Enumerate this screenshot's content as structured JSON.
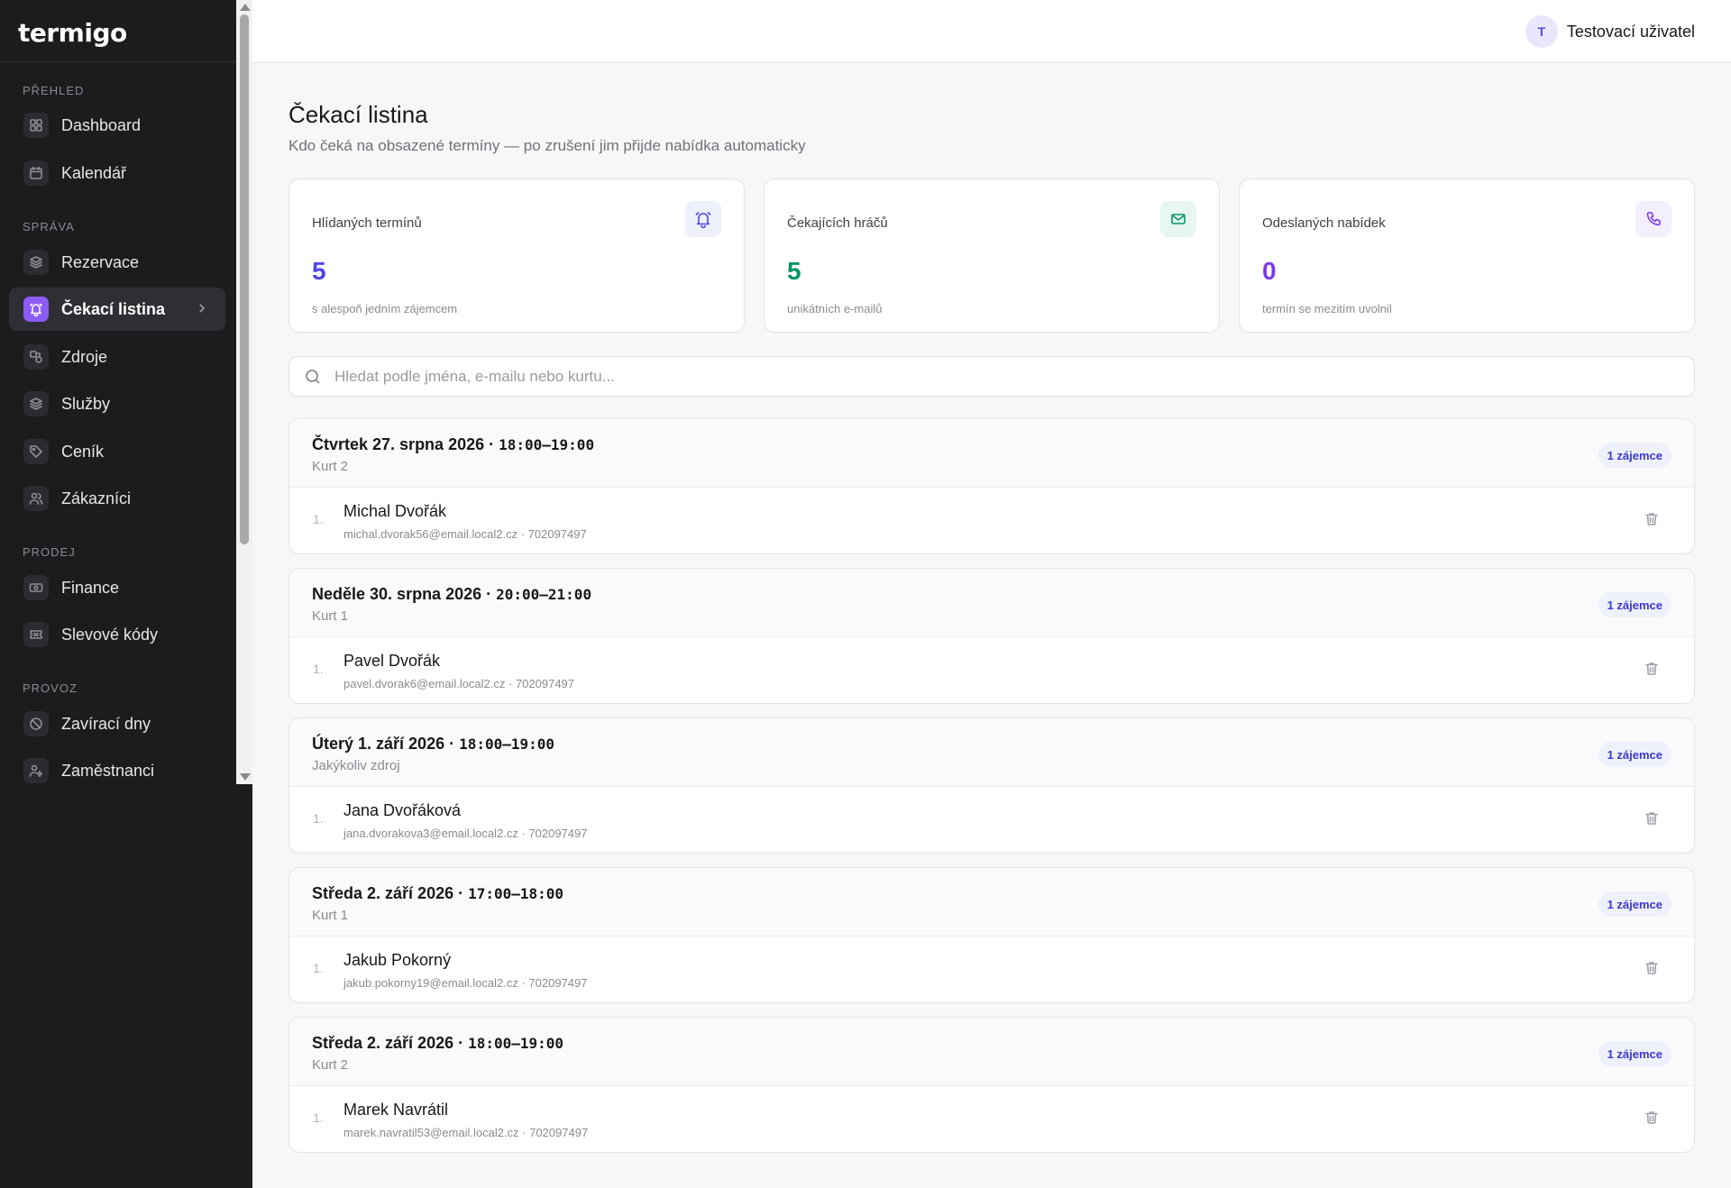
{
  "app": {
    "logo": "termigo"
  },
  "sidebar": {
    "sections": [
      {
        "label": "PŘEHLED"
      },
      {
        "label": "SPRÁVA"
      },
      {
        "label": "PRODEJ"
      },
      {
        "label": "PROVOZ"
      }
    ],
    "items": [
      {
        "label": "Dashboard",
        "icon": "dashboard-icon"
      },
      {
        "label": "Kalendář",
        "icon": "calendar-icon"
      },
      {
        "label": "Rezervace",
        "icon": "layers-icon"
      },
      {
        "label": "Čekací listina",
        "icon": "bell-icon",
        "active": true
      },
      {
        "label": "Zdroje",
        "icon": "resources-icon"
      },
      {
        "label": "Služby",
        "icon": "layers-icon"
      },
      {
        "label": "Ceník",
        "icon": "tag-icon"
      },
      {
        "label": "Zákazníci",
        "icon": "users-icon"
      },
      {
        "label": "Finance",
        "icon": "banknote-icon"
      },
      {
        "label": "Slevové kódy",
        "icon": "ticket-icon"
      },
      {
        "label": "Zavírací dny",
        "icon": "ban-icon"
      },
      {
        "label": "Zaměstnanci",
        "icon": "user-cog-icon"
      }
    ]
  },
  "topbar": {
    "avatar_initial": "T",
    "user_name": "Testovací uživatel"
  },
  "page": {
    "title": "Čekací listina",
    "subtitle": "Kdo čeká na obsazené termíny — po zrušení jim přijde nabídka automaticky"
  },
  "stats": [
    {
      "label": "Hlídaných termínů",
      "value": "5",
      "desc": "s alespoň jedním zájemcem",
      "icon": "bell-icon",
      "color": "#4f46e5",
      "bg": "#eef0fb"
    },
    {
      "label": "Čekajících hráčů",
      "value": "5",
      "desc": "unikátních e-mailů",
      "icon": "mail-icon",
      "color": "#059669",
      "bg": "#e7f7f0"
    },
    {
      "label": "Odeslaných nabídek",
      "value": "0",
      "desc": "termín se mezitím uvolnil",
      "icon": "phone-icon",
      "color": "#7c3aed",
      "bg": "#f3effd"
    }
  ],
  "search": {
    "placeholder": "Hledat podle jména, e-mailu nebo kurtu...",
    "value": ""
  },
  "groups": [
    {
      "date": "Čtvrtek 27. srpna 2026 · ",
      "time": "18:00–19:00",
      "resource": "Kurt 2",
      "badge": "1 zájemce",
      "entries": [
        {
          "num": "1.",
          "name": "Michal Dvořák",
          "meta": "michal.dvorak56@email.local2.cz · 702097497"
        }
      ]
    },
    {
      "date": "Neděle 30. srpna 2026 · ",
      "time": "20:00–21:00",
      "resource": "Kurt 1",
      "badge": "1 zájemce",
      "entries": [
        {
          "num": "1.",
          "name": "Pavel Dvořák",
          "meta": "pavel.dvorak6@email.local2.cz · 702097497"
        }
      ]
    },
    {
      "date": "Úterý 1. září 2026 · ",
      "time": "18:00–19:00",
      "resource": "Jakýkoliv zdroj",
      "badge": "1 zájemce",
      "entries": [
        {
          "num": "1.",
          "name": "Jana Dvořáková",
          "meta": "jana.dvorakova3@email.local2.cz · 702097497"
        }
      ]
    },
    {
      "date": "Středa 2. září 2026 · ",
      "time": "17:00–18:00",
      "resource": "Kurt 1",
      "badge": "1 zájemce",
      "entries": [
        {
          "num": "1.",
          "name": "Jakub Pokorný",
          "meta": "jakub.pokorny19@email.local2.cz · 702097497"
        }
      ]
    },
    {
      "date": "Středa 2. září 2026 · ",
      "time": "18:00–19:00",
      "resource": "Kurt 2",
      "badge": "1 zájemce",
      "entries": [
        {
          "num": "1.",
          "name": "Marek Navrátil",
          "meta": "marek.navratil53@email.local2.cz · 702097497"
        }
      ]
    }
  ]
}
